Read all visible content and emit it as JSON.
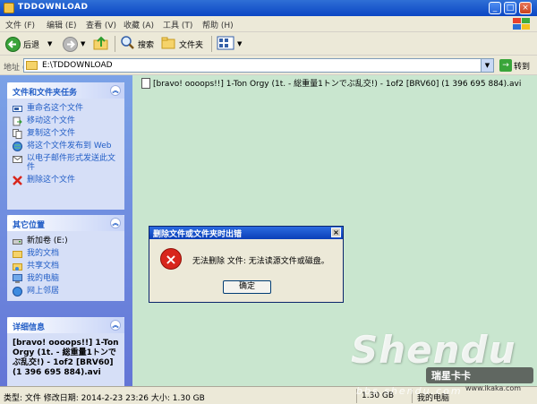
{
  "window": {
    "title": "TDDOWNLOAD"
  },
  "menu": {
    "items": [
      "文件 (F)",
      "编辑 (E)",
      "查看 (V)",
      "收藏 (A)",
      "工具 (T)",
      "帮助 (H)"
    ]
  },
  "toolbar": {
    "back": "后退",
    "search": "搜索",
    "folders": "文件夹"
  },
  "address": {
    "label": "地址 (D)",
    "path": "E:\\TDDOWNLOAD",
    "go": "转到"
  },
  "tasks_panel": {
    "title": "文件和文件夹任务",
    "items": [
      "重命名这个文件",
      "移动这个文件",
      "复制这个文件",
      "将这个文件发布到 Web",
      "以电子邮件形式发送此文件",
      "删除这个文件"
    ]
  },
  "places_panel": {
    "title": "其它位置",
    "items": [
      "新加卷 (E:)",
      "我的文档",
      "共享文档",
      "我的电脑",
      "网上邻居"
    ]
  },
  "details_panel": {
    "title": "详细信息",
    "text": "[bravo! oooops!!] 1-Ton Orgy (1t. - 総重量1トンでぶ乱交!) - 1of2 [BRV60] (1 396 695 884).avi"
  },
  "file": {
    "name": "[bravo! oooops!!] 1-Ton Orgy (1t. - 総重量1トンでぶ乱交!) - 1of2 [BRV60] (1 396 695 884).avi"
  },
  "dialog": {
    "title": "删除文件或文件夹时出错",
    "message": "无法删除 文件: 无法读源文件或磁盘。",
    "ok": "确定"
  },
  "status": {
    "text": "类型: 文件 修改日期: 2014-2-23 23:26 大小: 1.30 GB",
    "size": "1.30 GB",
    "location": "我的电脑"
  },
  "watermark": {
    "brand": "Shendu",
    "badge": "瑞星卡卡",
    "url": "www.ikaka.com",
    "site": "bbs.shendu.com"
  },
  "colors": {
    "title_blue": "#0b46c4",
    "task_pane": "#6375d6",
    "error_red": "#d8261c",
    "desktop_green": "#c9e6cf"
  }
}
